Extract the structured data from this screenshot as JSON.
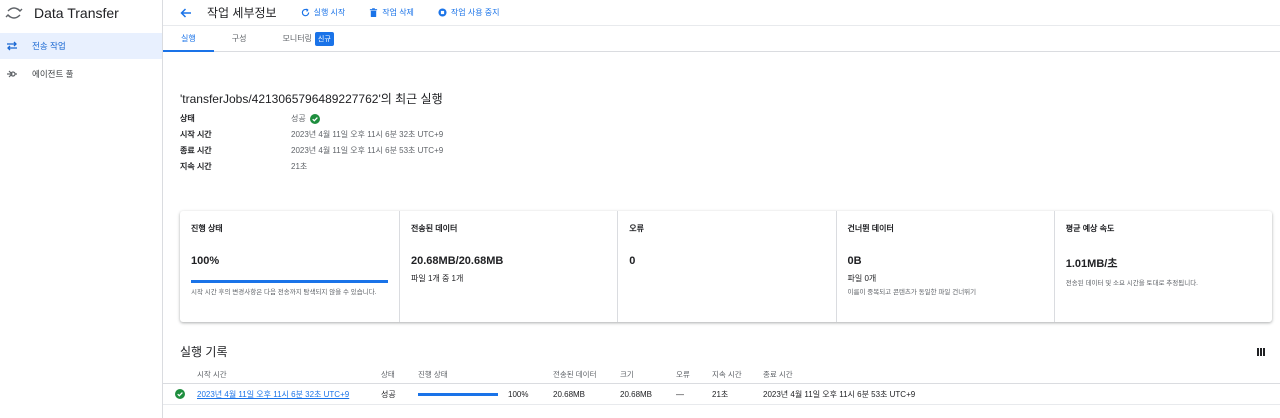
{
  "sidebar": {
    "product_title": "Data Transfer",
    "items": [
      {
        "label": "전송 작업",
        "icon": "transfer-arrows-icon",
        "active": true
      },
      {
        "label": "에이전트 풀",
        "icon": "agent-pool-icon",
        "active": false
      }
    ]
  },
  "header": {
    "title": "작업 세부정보",
    "actions": [
      {
        "label": "실행 시작",
        "icon": "refresh-icon"
      },
      {
        "label": "작업 삭제",
        "icon": "trash-icon"
      },
      {
        "label": "작업 사용 중지",
        "icon": "disable-icon"
      }
    ]
  },
  "tabs": [
    {
      "label": "실행",
      "active": true
    },
    {
      "label": "구성",
      "active": false
    },
    {
      "label": "모니터링",
      "active": false,
      "badge": "신규"
    }
  ],
  "run": {
    "title": "'transferJobs/4213065796489227762'의 최근 실행",
    "details": [
      {
        "key": "상태",
        "value": "성공"
      },
      {
        "key": "시작 시간",
        "value": "2023년 4월 11일 오후 11시 6분 32초 UTC+9"
      },
      {
        "key": "종료 시간",
        "value": "2023년 4월 11일 오후 11시 6분 53초 UTC+9"
      },
      {
        "key": "지속 시간",
        "value": "21초"
      }
    ]
  },
  "stats": [
    {
      "label": "진행 상태",
      "value": "100%",
      "progress": 1.0,
      "note": "시작 시간 후의 변경사항은 다음 전송까지 탐색되지 않을 수 있습니다."
    },
    {
      "label": "전송된 데이터",
      "value": "20.68MB/20.68MB",
      "sub": "파일 1개 중 1개"
    },
    {
      "label": "오류",
      "value": "0"
    },
    {
      "label": "건너뛴 데이터",
      "value": "0B",
      "sub": "파일 0개",
      "note": "이름이 중복되고 콘텐츠가 동일한 파일 건너뛰기"
    },
    {
      "label": "평균 예상 속도",
      "value": "1.01MB/초",
      "note": "전송된 데이터 및 소요 시간을 토대로 추정됩니다."
    }
  ],
  "history": {
    "title": "실행 기록",
    "columns": [
      "시작 시간",
      "상태",
      "진행 상태",
      "전송된 데이터",
      "크기",
      "오류",
      "지속 시간",
      "종료 시간"
    ],
    "rows": [
      {
        "start": "2023년 4월 11일 오후 11시 6분 32초 UTC+9",
        "status": "성공",
        "progress": "100%",
        "transferred": "20.68MB",
        "size": "20.68MB",
        "errors": "—",
        "duration": "21초",
        "end": "2023년 4월 11일 오후 11시 6분 53초 UTC+9"
      }
    ]
  },
  "colors": {
    "accent": "#1a73e8",
    "success": "#1e8e3e",
    "active_bg": "#e8f0fe"
  }
}
